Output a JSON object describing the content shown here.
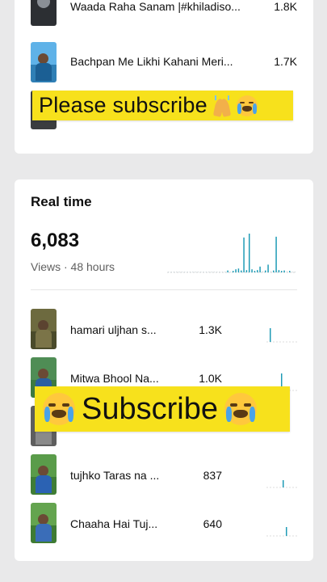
{
  "top_list": [
    {
      "title": "Waada Raha Sanam |#khiladiso...",
      "count": "1.8K",
      "thumb": "dark-round"
    },
    {
      "title": "Bachpan Me Likhi Kahani Meri...",
      "count": "1.7K",
      "thumb": "person-blue"
    },
    {
      "title": "",
      "count": "",
      "thumb": "person-dark"
    }
  ],
  "realtime": {
    "title": "Real time",
    "views_value": "6,083",
    "views_label": "Views · 48 hours",
    "items": [
      {
        "title": "hamari uljhan s...",
        "count": "1.3K",
        "thumb": "olive"
      },
      {
        "title": "Mitwa Bhool Na...",
        "count": "1.0K",
        "thumb": "green-field"
      },
      {
        "title": "",
        "count": "",
        "thumb": "grey"
      },
      {
        "title": "tujhko Taras na ...",
        "count": "837",
        "thumb": "green-field"
      },
      {
        "title": "Chaaha Hai Tuj...",
        "count": "640",
        "thumb": "green-field"
      }
    ]
  },
  "overlays": {
    "banner1_text": "Please subscribe",
    "banner2_text": "Subscribe"
  },
  "colors": {
    "accent": "#1f9bb6",
    "banner": "#f7e11c",
    "card": "#ffffff",
    "background": "#e9e9ea"
  },
  "chart_data": {
    "type": "bar",
    "title": "",
    "series": [
      {
        "values": [
          0.02,
          0.02,
          0.02,
          0.02,
          0.02,
          0.02,
          0.02,
          0.02,
          0.02,
          0.02,
          0.02,
          0.02,
          0.02,
          0.02,
          0.02,
          0.02,
          0.02,
          0.02,
          0.02,
          0.02,
          0.02,
          0.02,
          0.05,
          0.02,
          0.04,
          0.08,
          0.1,
          0.05,
          0.9,
          0.06,
          1.0,
          0.08,
          0.04,
          0.06,
          0.15,
          0.03,
          0.05,
          0.2,
          0.03,
          0.05,
          0.92,
          0.06,
          0.04,
          0.05,
          0.03,
          0.04,
          0.02,
          0.02
        ]
      }
    ]
  }
}
